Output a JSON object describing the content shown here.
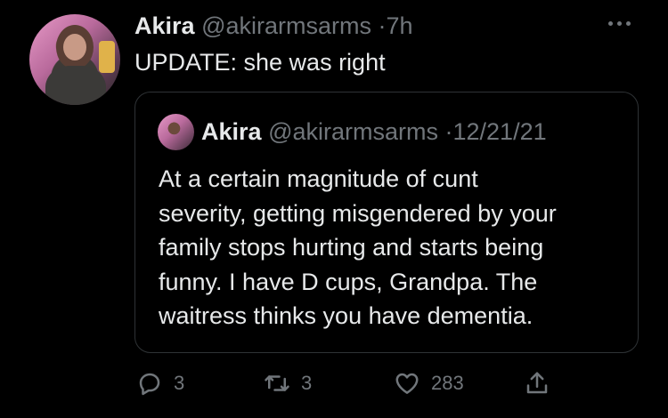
{
  "tweet": {
    "display_name": "Akira",
    "handle": "@akirarmsarms",
    "separator": "·",
    "time": "7h",
    "text": "UPDATE: she was right"
  },
  "quoted_tweet": {
    "display_name": "Akira",
    "handle": "@akirarmsarms",
    "separator": "·",
    "date": "12/21/21",
    "lines": [
      "At a certain magnitude of cunt",
      "severity, getting misgendered by your",
      "family stops hurting and starts being",
      "funny. I have D cups, Grandpa. The",
      "waitress thinks you have dementia."
    ]
  },
  "actions": {
    "reply_count": "3",
    "retweet_count": "3",
    "like_count": "283"
  },
  "icons": {
    "more": "more-horizontal-icon",
    "reply": "reply-icon",
    "retweet": "retweet-icon",
    "like": "heart-icon",
    "share": "share-icon"
  },
  "colors": {
    "background": "#000000",
    "text": "#e7e9ea",
    "muted": "#71767b",
    "border": "#2f3336"
  }
}
